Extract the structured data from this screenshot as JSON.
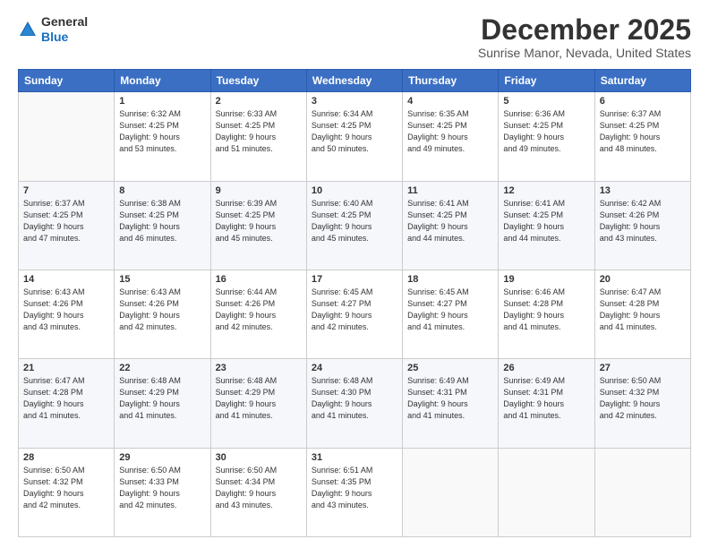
{
  "logo": {
    "general": "General",
    "blue": "Blue"
  },
  "header": {
    "month": "December 2025",
    "location": "Sunrise Manor, Nevada, United States"
  },
  "days_of_week": [
    "Sunday",
    "Monday",
    "Tuesday",
    "Wednesday",
    "Thursday",
    "Friday",
    "Saturday"
  ],
  "weeks": [
    [
      {
        "day": "",
        "info": ""
      },
      {
        "day": "1",
        "info": "Sunrise: 6:32 AM\nSunset: 4:25 PM\nDaylight: 9 hours\nand 53 minutes."
      },
      {
        "day": "2",
        "info": "Sunrise: 6:33 AM\nSunset: 4:25 PM\nDaylight: 9 hours\nand 51 minutes."
      },
      {
        "day": "3",
        "info": "Sunrise: 6:34 AM\nSunset: 4:25 PM\nDaylight: 9 hours\nand 50 minutes."
      },
      {
        "day": "4",
        "info": "Sunrise: 6:35 AM\nSunset: 4:25 PM\nDaylight: 9 hours\nand 49 minutes."
      },
      {
        "day": "5",
        "info": "Sunrise: 6:36 AM\nSunset: 4:25 PM\nDaylight: 9 hours\nand 49 minutes."
      },
      {
        "day": "6",
        "info": "Sunrise: 6:37 AM\nSunset: 4:25 PM\nDaylight: 9 hours\nand 48 minutes."
      }
    ],
    [
      {
        "day": "7",
        "info": "Sunrise: 6:37 AM\nSunset: 4:25 PM\nDaylight: 9 hours\nand 47 minutes."
      },
      {
        "day": "8",
        "info": "Sunrise: 6:38 AM\nSunset: 4:25 PM\nDaylight: 9 hours\nand 46 minutes."
      },
      {
        "day": "9",
        "info": "Sunrise: 6:39 AM\nSunset: 4:25 PM\nDaylight: 9 hours\nand 45 minutes."
      },
      {
        "day": "10",
        "info": "Sunrise: 6:40 AM\nSunset: 4:25 PM\nDaylight: 9 hours\nand 45 minutes."
      },
      {
        "day": "11",
        "info": "Sunrise: 6:41 AM\nSunset: 4:25 PM\nDaylight: 9 hours\nand 44 minutes."
      },
      {
        "day": "12",
        "info": "Sunrise: 6:41 AM\nSunset: 4:25 PM\nDaylight: 9 hours\nand 44 minutes."
      },
      {
        "day": "13",
        "info": "Sunrise: 6:42 AM\nSunset: 4:26 PM\nDaylight: 9 hours\nand 43 minutes."
      }
    ],
    [
      {
        "day": "14",
        "info": "Sunrise: 6:43 AM\nSunset: 4:26 PM\nDaylight: 9 hours\nand 43 minutes."
      },
      {
        "day": "15",
        "info": "Sunrise: 6:43 AM\nSunset: 4:26 PM\nDaylight: 9 hours\nand 42 minutes."
      },
      {
        "day": "16",
        "info": "Sunrise: 6:44 AM\nSunset: 4:26 PM\nDaylight: 9 hours\nand 42 minutes."
      },
      {
        "day": "17",
        "info": "Sunrise: 6:45 AM\nSunset: 4:27 PM\nDaylight: 9 hours\nand 42 minutes."
      },
      {
        "day": "18",
        "info": "Sunrise: 6:45 AM\nSunset: 4:27 PM\nDaylight: 9 hours\nand 41 minutes."
      },
      {
        "day": "19",
        "info": "Sunrise: 6:46 AM\nSunset: 4:28 PM\nDaylight: 9 hours\nand 41 minutes."
      },
      {
        "day": "20",
        "info": "Sunrise: 6:47 AM\nSunset: 4:28 PM\nDaylight: 9 hours\nand 41 minutes."
      }
    ],
    [
      {
        "day": "21",
        "info": "Sunrise: 6:47 AM\nSunset: 4:28 PM\nDaylight: 9 hours\nand 41 minutes."
      },
      {
        "day": "22",
        "info": "Sunrise: 6:48 AM\nSunset: 4:29 PM\nDaylight: 9 hours\nand 41 minutes."
      },
      {
        "day": "23",
        "info": "Sunrise: 6:48 AM\nSunset: 4:29 PM\nDaylight: 9 hours\nand 41 minutes."
      },
      {
        "day": "24",
        "info": "Sunrise: 6:48 AM\nSunset: 4:30 PM\nDaylight: 9 hours\nand 41 minutes."
      },
      {
        "day": "25",
        "info": "Sunrise: 6:49 AM\nSunset: 4:31 PM\nDaylight: 9 hours\nand 41 minutes."
      },
      {
        "day": "26",
        "info": "Sunrise: 6:49 AM\nSunset: 4:31 PM\nDaylight: 9 hours\nand 41 minutes."
      },
      {
        "day": "27",
        "info": "Sunrise: 6:50 AM\nSunset: 4:32 PM\nDaylight: 9 hours\nand 42 minutes."
      }
    ],
    [
      {
        "day": "28",
        "info": "Sunrise: 6:50 AM\nSunset: 4:32 PM\nDaylight: 9 hours\nand 42 minutes."
      },
      {
        "day": "29",
        "info": "Sunrise: 6:50 AM\nSunset: 4:33 PM\nDaylight: 9 hours\nand 42 minutes."
      },
      {
        "day": "30",
        "info": "Sunrise: 6:50 AM\nSunset: 4:34 PM\nDaylight: 9 hours\nand 43 minutes."
      },
      {
        "day": "31",
        "info": "Sunrise: 6:51 AM\nSunset: 4:35 PM\nDaylight: 9 hours\nand 43 minutes."
      },
      {
        "day": "",
        "info": ""
      },
      {
        "day": "",
        "info": ""
      },
      {
        "day": "",
        "info": ""
      }
    ]
  ]
}
